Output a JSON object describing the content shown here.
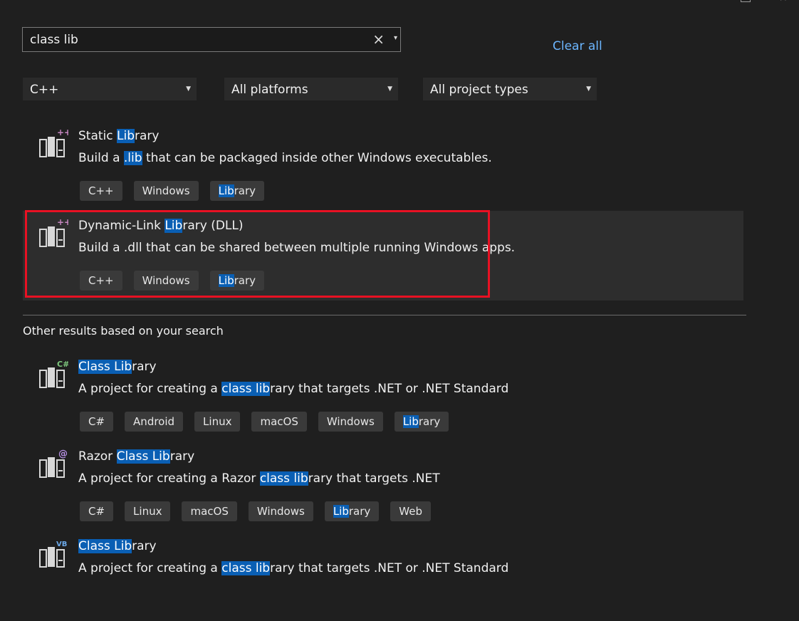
{
  "search": {
    "query": "class lib",
    "clear_icon": "×",
    "dropdown_icon": "▾"
  },
  "clear_all": "Clear all",
  "filters": [
    {
      "value": "C++"
    },
    {
      "value": "All platforms"
    },
    {
      "value": "All project types"
    }
  ],
  "templates": [
    {
      "icon": "static-library-icon",
      "title": [
        {
          "t": "Static "
        },
        {
          "t": "Lib",
          "h": true
        },
        {
          "t": "rary"
        }
      ],
      "desc": [
        {
          "t": "Build a "
        },
        {
          "t": ".lib",
          "h": true
        },
        {
          "t": " that can be packaged inside other Windows executables."
        }
      ],
      "tags": [
        [
          {
            "t": "C++"
          }
        ],
        [
          {
            "t": "Windows"
          }
        ],
        [
          {
            "t": "Lib",
            "h": true
          },
          {
            "t": "rary"
          }
        ]
      ]
    },
    {
      "icon": "dll-icon",
      "selected": true,
      "title": [
        {
          "t": "Dynamic-Link "
        },
        {
          "t": "Lib",
          "h": true
        },
        {
          "t": "rary (DLL)"
        }
      ],
      "desc": [
        {
          "t": "Build a .dll that can be shared between multiple running Windows apps."
        }
      ],
      "tags": [
        [
          {
            "t": "C++"
          }
        ],
        [
          {
            "t": "Windows"
          }
        ],
        [
          {
            "t": "Lib",
            "h": true
          },
          {
            "t": "rary"
          }
        ]
      ]
    }
  ],
  "other_header": "Other results based on your search",
  "other_templates": [
    {
      "icon": "csharp-class-library-icon",
      "badge": "C#",
      "title": [
        {
          "t": "Class Lib",
          "h": true
        },
        {
          "t": "rary"
        }
      ],
      "desc": [
        {
          "t": "A project for creating a "
        },
        {
          "t": "class lib",
          "h": true
        },
        {
          "t": "rary that targets .NET or .NET Standard"
        }
      ],
      "tags": [
        [
          {
            "t": "C#"
          }
        ],
        [
          {
            "t": "Android"
          }
        ],
        [
          {
            "t": "Linux"
          }
        ],
        [
          {
            "t": "macOS"
          }
        ],
        [
          {
            "t": "Windows"
          }
        ],
        [
          {
            "t": "Lib",
            "h": true
          },
          {
            "t": "rary"
          }
        ]
      ]
    },
    {
      "icon": "razor-class-library-icon",
      "badge": "@",
      "title": [
        {
          "t": "Razor "
        },
        {
          "t": "Class Lib",
          "h": true
        },
        {
          "t": "rary"
        }
      ],
      "desc": [
        {
          "t": "A project for creating a Razor "
        },
        {
          "t": "class lib",
          "h": true
        },
        {
          "t": "rary that targets .NET"
        }
      ],
      "tags": [
        [
          {
            "t": "C#"
          }
        ],
        [
          {
            "t": "Linux"
          }
        ],
        [
          {
            "t": "macOS"
          }
        ],
        [
          {
            "t": "Windows"
          }
        ],
        [
          {
            "t": "Lib",
            "h": true
          },
          {
            "t": "rary"
          }
        ],
        [
          {
            "t": "Web"
          }
        ]
      ]
    },
    {
      "icon": "vb-class-library-icon",
      "badge": "VB",
      "title": [
        {
          "t": "Class Lib",
          "h": true
        },
        {
          "t": "rary"
        }
      ],
      "desc": [
        {
          "t": "A project for creating a "
        },
        {
          "t": "class lib",
          "h": true
        },
        {
          "t": "rary that targets .NET or .NET Standard"
        }
      ],
      "tags": []
    }
  ],
  "colors": {
    "highlight": "#0a5fb4",
    "link": "#6cb6ff",
    "selection_border": "#e81123",
    "background": "#1f1f1f"
  }
}
